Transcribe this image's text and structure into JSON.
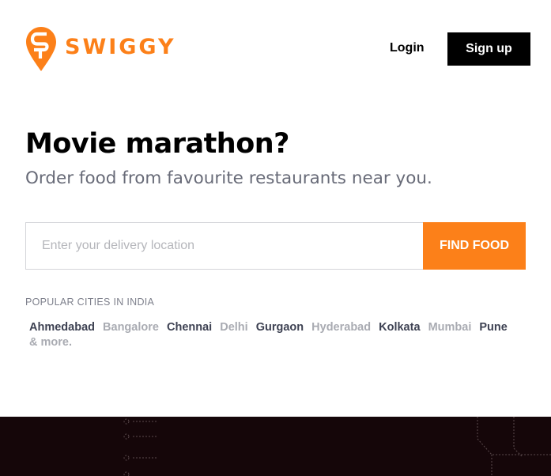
{
  "brand": {
    "name": "SWIGGY",
    "accent_color": "#fc8019"
  },
  "header": {
    "login_label": "Login",
    "signup_label": "Sign up"
  },
  "hero": {
    "title": "Movie marathon?",
    "subtitle": "Order food from favourite restaurants near you."
  },
  "search": {
    "placeholder": "Enter your delivery location",
    "value": "",
    "button_label": "FIND FOOD"
  },
  "popular": {
    "heading": "POPULAR CITIES IN INDIA",
    "cities": [
      {
        "name": "Ahmedabad",
        "tone": "dark"
      },
      {
        "name": "Bangalore",
        "tone": "light"
      },
      {
        "name": "Chennai",
        "tone": "dark"
      },
      {
        "name": "Delhi",
        "tone": "light"
      },
      {
        "name": "Gurgaon",
        "tone": "dark"
      },
      {
        "name": "Hyderabad",
        "tone": "light"
      },
      {
        "name": "Kolkata",
        "tone": "dark"
      },
      {
        "name": "Mumbai",
        "tone": "light"
      },
      {
        "name": "Pune",
        "tone": "dark"
      }
    ],
    "more_label": "& more."
  },
  "footer": {
    "background_color": "#150609"
  }
}
